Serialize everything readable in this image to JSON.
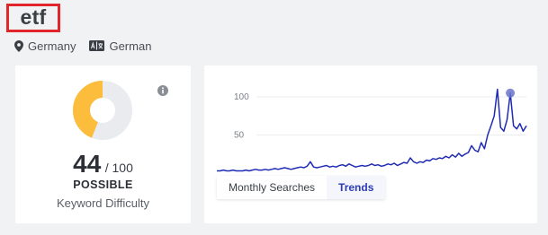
{
  "keyword": "etf",
  "location": "Germany",
  "language": "German",
  "keyword_difficulty": {
    "value": "44",
    "max": "/ 100",
    "level": "POSSIBLE",
    "caption": "Keyword Difficulty",
    "fraction": 0.44
  },
  "trends": {
    "tabs": [
      {
        "label": "Monthly Searches",
        "active": false
      },
      {
        "label": "Trends",
        "active": true
      }
    ]
  },
  "chart_data": {
    "type": "line",
    "title": "",
    "xlabel": "",
    "ylabel": "",
    "y_ticks": [
      "100",
      "50"
    ],
    "ylim": [
      0,
      120
    ],
    "series": [
      {
        "values": [
          3,
          3,
          4,
          3,
          3,
          4,
          3,
          3,
          3,
          4,
          3,
          4,
          5,
          4,
          4,
          5,
          4,
          5,
          6,
          5,
          6,
          7,
          6,
          5,
          6,
          7,
          8,
          7,
          9,
          15,
          8,
          7,
          8,
          9,
          10,
          8,
          9,
          8,
          10,
          11,
          9,
          12,
          10,
          8,
          9,
          10,
          9,
          10,
          12,
          10,
          11,
          9,
          10,
          12,
          11,
          13,
          10,
          12,
          14,
          13,
          20,
          15,
          13,
          15,
          14,
          17,
          16,
          19,
          18,
          20,
          19,
          22,
          20,
          24,
          21,
          26,
          22,
          25,
          27,
          36,
          30,
          28,
          40,
          32,
          50,
          62,
          75,
          110,
          60,
          55,
          70,
          105,
          62,
          58,
          65,
          55,
          62
        ]
      }
    ],
    "highlight_point": {
      "index": 91,
      "value": 105
    },
    "line_color": "#1f2bb5"
  }
}
